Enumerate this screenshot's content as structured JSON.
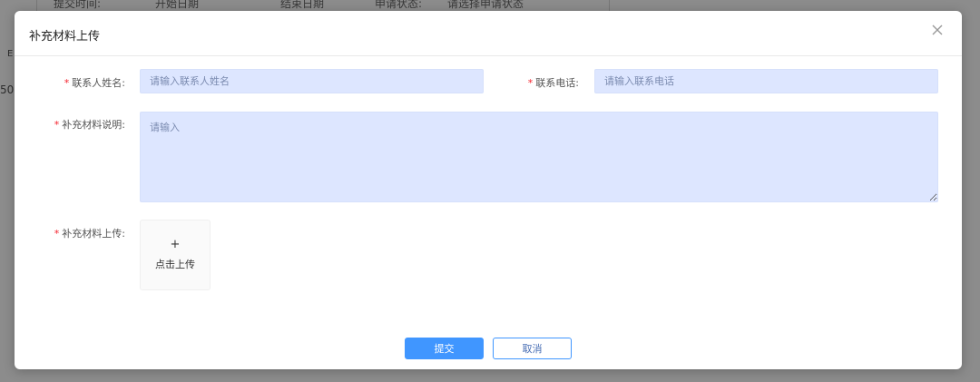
{
  "background": {
    "filter": {
      "submit_time_label": "提交时间:",
      "start_date": "开始日期",
      "end_date": "结束日期",
      "status_label": "申请状态:",
      "status_placeholder": "请选择申请状态"
    },
    "left_fragment_1": "E",
    "left_fragment_2": "50"
  },
  "dialog": {
    "title": "补充材料上传",
    "fields": {
      "contact_name": {
        "label": "联系人姓名:",
        "required": "*",
        "placeholder": "请输入联系人姓名",
        "value": ""
      },
      "contact_phone": {
        "label": "联系电话:",
        "required": "*",
        "placeholder": "请输入联系电话",
        "value": ""
      },
      "description": {
        "label": "补充材料说明:",
        "required": "*",
        "placeholder": "请输入",
        "value": ""
      },
      "upload": {
        "label": "补充材料上传:",
        "required": "*",
        "plus": "+",
        "text": "点击上传"
      }
    },
    "buttons": {
      "submit": "提交",
      "cancel": "取消"
    }
  },
  "colors": {
    "input_bg": "#dde6ff",
    "primary": "#4096ff",
    "required": "#f5222d"
  },
  "icons": {
    "close": "close-icon"
  }
}
